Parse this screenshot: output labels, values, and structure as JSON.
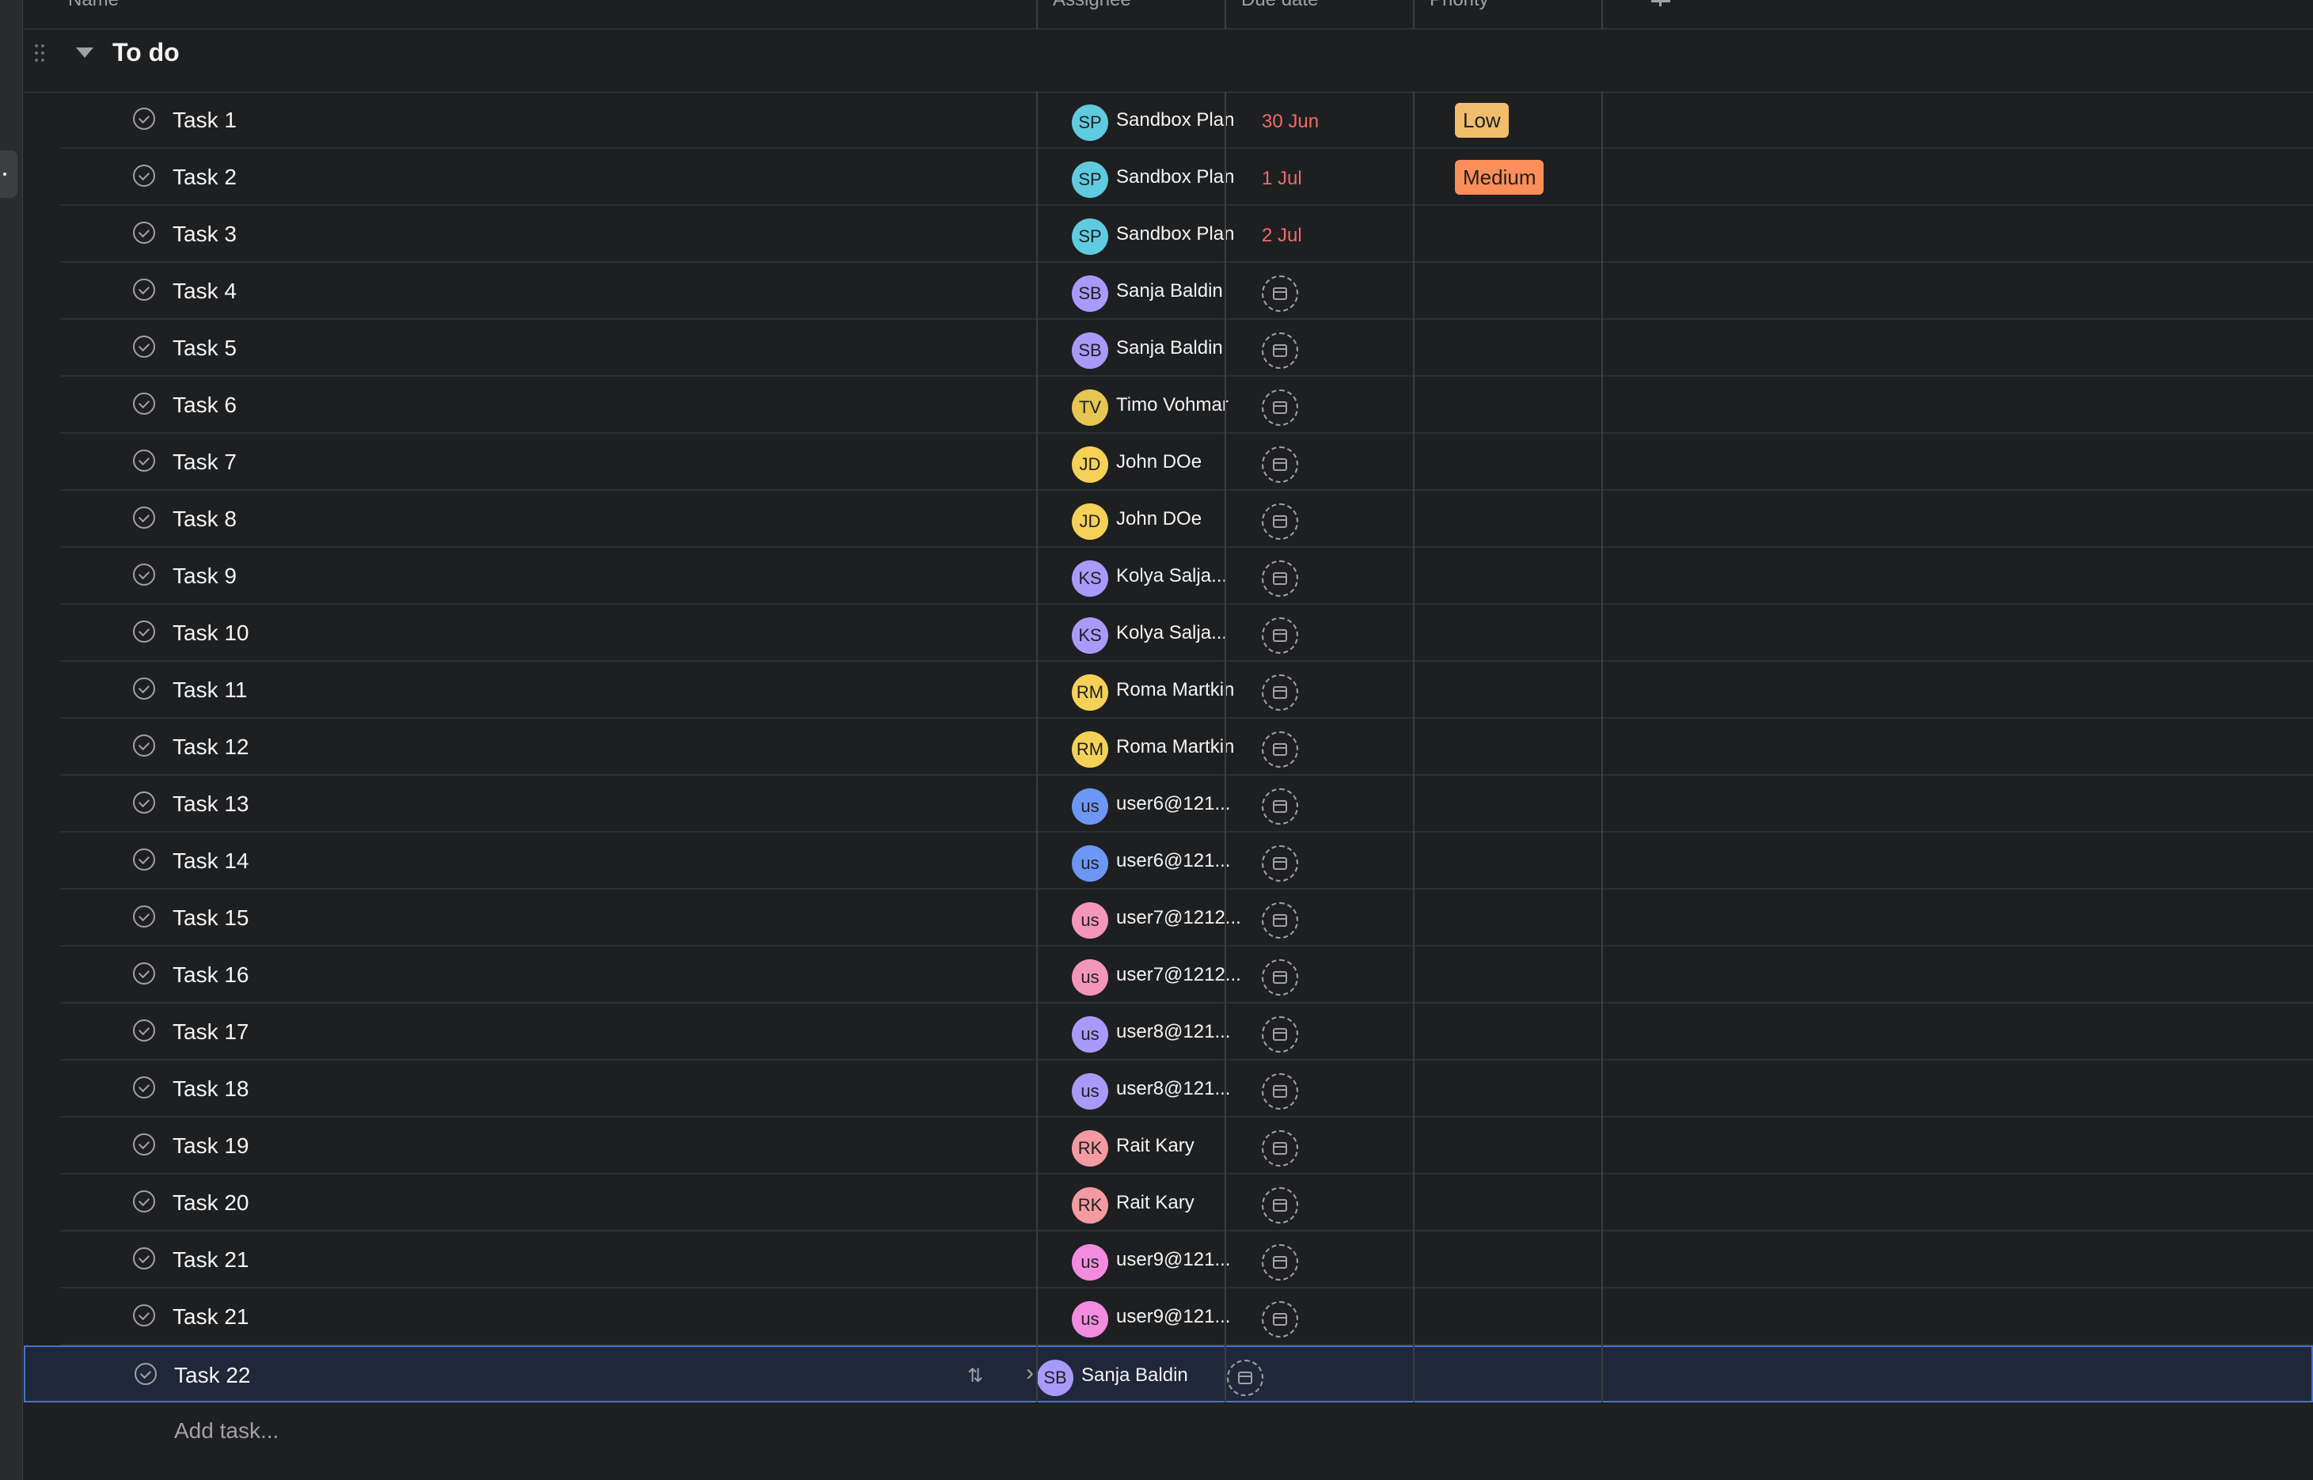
{
  "columns": {
    "name": "Name",
    "assignee": "Assignee",
    "due": "Due date",
    "priority": "Priority"
  },
  "section": {
    "title": "To do"
  },
  "colors": {
    "overdue": "#f06a6a",
    "priority_low": "#f1bd6c",
    "priority_medium": "#fc8f59",
    "selected_border": "#4573d2"
  },
  "rows": [
    {
      "name": "Task 1",
      "initials": "SP",
      "assignee": "Sandbox Plan",
      "avatar_color": "#5fcbe0",
      "due": "30 Jun",
      "priority": "Low"
    },
    {
      "name": "Task 2",
      "initials": "SP",
      "assignee": "Sandbox Plan",
      "avatar_color": "#5fcbe0",
      "due": "1 Jul",
      "priority": "Medium"
    },
    {
      "name": "Task 3",
      "initials": "SP",
      "assignee": "Sandbox Plan",
      "avatar_color": "#5fcbe0",
      "due": "2 Jul",
      "priority": ""
    },
    {
      "name": "Task 4",
      "initials": "SB",
      "assignee": "Sanja Baldin",
      "avatar_color": "#a99afa",
      "due": "",
      "priority": ""
    },
    {
      "name": "Task 5",
      "initials": "SB",
      "assignee": "Sanja Baldin",
      "avatar_color": "#a99afa",
      "due": "",
      "priority": ""
    },
    {
      "name": "Task 6",
      "initials": "TV",
      "assignee": "Timo Vohmar",
      "avatar_color": "#e6c651",
      "due": "",
      "priority": ""
    },
    {
      "name": "Task 7",
      "initials": "JD",
      "assignee": "John DOe",
      "avatar_color": "#f5d257",
      "due": "",
      "priority": ""
    },
    {
      "name": "Task 8",
      "initials": "JD",
      "assignee": "John DOe",
      "avatar_color": "#f5d257",
      "due": "",
      "priority": ""
    },
    {
      "name": "Task 9",
      "initials": "KS",
      "assignee": "Kolya Salja...",
      "avatar_color": "#a99afa",
      "due": "",
      "priority": ""
    },
    {
      "name": "Task 10",
      "initials": "KS",
      "assignee": "Kolya Salja...",
      "avatar_color": "#a99afa",
      "due": "",
      "priority": ""
    },
    {
      "name": "Task 11",
      "initials": "RM",
      "assignee": "Roma Martkin",
      "avatar_color": "#f5d257",
      "due": "",
      "priority": ""
    },
    {
      "name": "Task 12",
      "initials": "RM",
      "assignee": "Roma Martkin",
      "avatar_color": "#f5d257",
      "due": "",
      "priority": ""
    },
    {
      "name": "Task 13",
      "initials": "us",
      "assignee": "user6@121...",
      "avatar_color": "#6d97f4",
      "due": "",
      "priority": ""
    },
    {
      "name": "Task 14",
      "initials": "us",
      "assignee": "user6@121...",
      "avatar_color": "#6d97f4",
      "due": "",
      "priority": ""
    },
    {
      "name": "Task 15",
      "initials": "us",
      "assignee": "user7@1212...",
      "avatar_color": "#f496b8",
      "due": "",
      "priority": ""
    },
    {
      "name": "Task 16",
      "initials": "us",
      "assignee": "user7@1212...",
      "avatar_color": "#f496b8",
      "due": "",
      "priority": ""
    },
    {
      "name": "Task 17",
      "initials": "us",
      "assignee": "user8@121...",
      "avatar_color": "#a99afa",
      "due": "",
      "priority": ""
    },
    {
      "name": "Task 18",
      "initials": "us",
      "assignee": "user8@121...",
      "avatar_color": "#a99afa",
      "due": "",
      "priority": ""
    },
    {
      "name": "Task 19",
      "initials": "RK",
      "assignee": "Rait Kary",
      "avatar_color": "#f59aa0",
      "due": "",
      "priority": ""
    },
    {
      "name": "Task 20",
      "initials": "RK",
      "assignee": "Rait Kary",
      "avatar_color": "#f59aa0",
      "due": "",
      "priority": ""
    },
    {
      "name": "Task 21",
      "initials": "us",
      "assignee": "user9@121...",
      "avatar_color": "#f38ce0",
      "due": "",
      "priority": ""
    },
    {
      "name": "Task 21",
      "initials": "us",
      "assignee": "user9@121...",
      "avatar_color": "#f38ce0",
      "due": "",
      "priority": ""
    },
    {
      "name": "Task 22",
      "initials": "SB",
      "assignee": "Sanja Baldin",
      "avatar_color": "#a99afa",
      "due": "",
      "priority": "",
      "selected": true
    }
  ],
  "add_task": "Add task..."
}
